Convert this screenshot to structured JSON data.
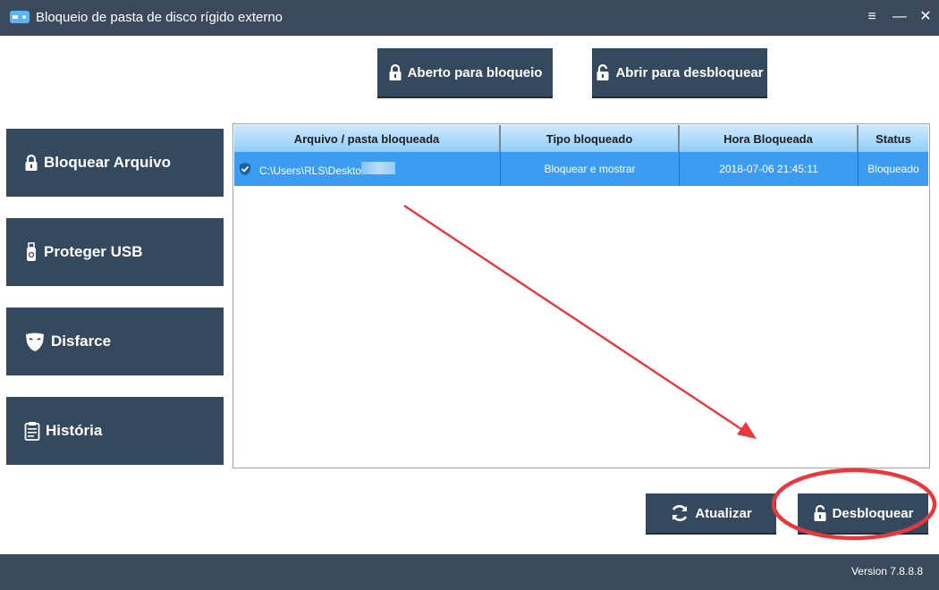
{
  "window": {
    "title": "Bloqueio de pasta de disco rígido externo",
    "controls": {
      "menu": "≡",
      "minimize": "—",
      "close": "✕"
    }
  },
  "toolbar": {
    "lock_label": "Aberto para bloqueio",
    "unlock_label": "Abrir para desbloquear"
  },
  "sidebar": {
    "items": [
      {
        "label": "Bloquear Arquivo",
        "icon": "lock-icon"
      },
      {
        "label": "Proteger USB",
        "icon": "usb-icon"
      },
      {
        "label": "Disfarce",
        "icon": "mask-icon"
      },
      {
        "label": "História",
        "icon": "clipboard-icon"
      }
    ]
  },
  "table": {
    "headers": [
      "Arquivo / pasta bloqueada",
      "Tipo bloqueado",
      "Hora Bloqueada",
      "Status"
    ],
    "rows": [
      {
        "path": "C:\\Users\\RLS\\Deskto",
        "type": "Bloquear e mostrar",
        "time": "2018-07-06 21:45:11",
        "status": "Bloqueado",
        "checked": true,
        "selected": true
      }
    ]
  },
  "actions": {
    "refresh_label": "Atualizar",
    "unlock_label": "Desbloquear"
  },
  "footer": {
    "version": "Version 7.8.8.8"
  },
  "colors": {
    "titlebar": "#3a4a5c",
    "button": "#34495e",
    "selection": "#3c9cf2",
    "annotation": "#e8383d"
  }
}
